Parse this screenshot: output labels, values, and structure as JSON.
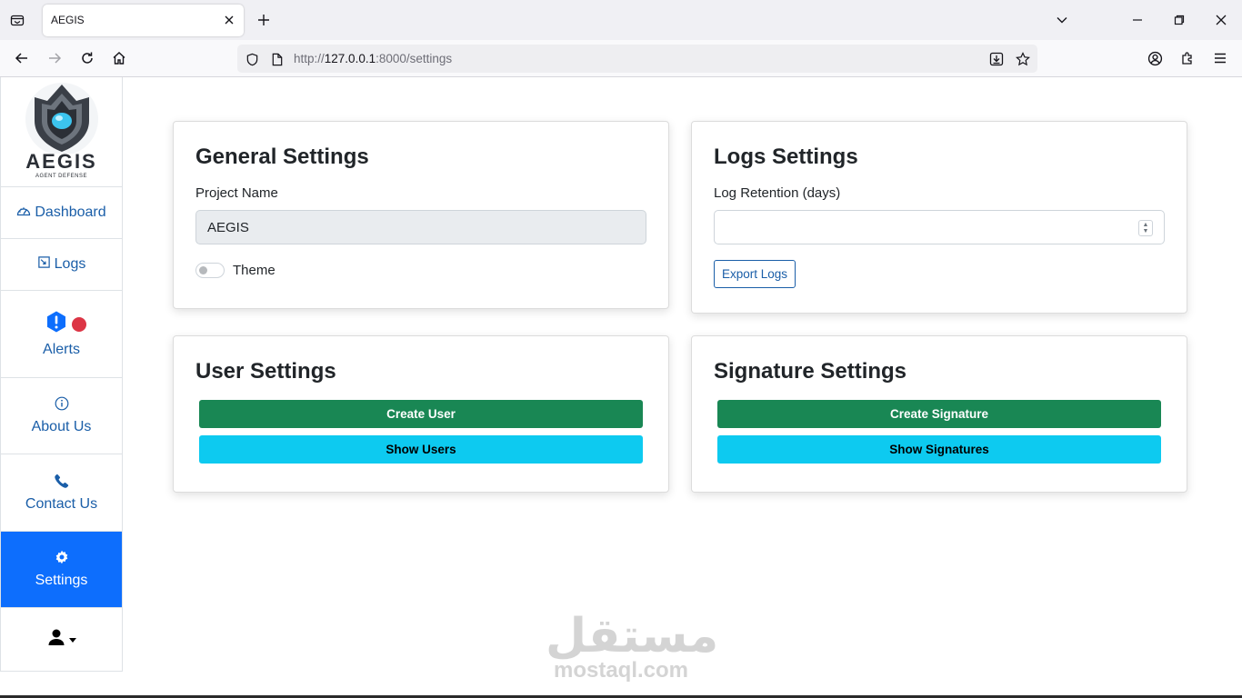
{
  "browser": {
    "tab_title": "AEGIS",
    "url_prefix": "http://",
    "url_host": "127.0.0.1",
    "url_path": ":8000/settings"
  },
  "sidebar": {
    "logo_word": "AEGIS",
    "logo_tag": "AGENT DEFENSE",
    "items": [
      {
        "label": "Dashboard",
        "icon": "speedometer-icon"
      },
      {
        "label": "Logs",
        "icon": "logs-icon"
      },
      {
        "label": "Alerts",
        "icon": "alert-icon"
      },
      {
        "label": "About Us",
        "icon": "info-icon"
      },
      {
        "label": "Contact Us",
        "icon": "phone-icon"
      },
      {
        "label": "Settings",
        "icon": "gear-icon"
      }
    ],
    "accent": "#0d6efd"
  },
  "general": {
    "title": "General Settings",
    "project_label": "Project Name",
    "project_value": "AEGIS",
    "theme_label": "Theme"
  },
  "logs": {
    "title": "Logs Settings",
    "retention_label": "Log Retention (days)",
    "retention_value": "",
    "export_label": "Export Logs"
  },
  "users": {
    "title": "User Settings",
    "create_label": "Create User",
    "show_label": "Show Users"
  },
  "signatures": {
    "title": "Signature Settings",
    "create_label": "Create Signature",
    "show_label": "Show Signatures"
  },
  "watermark": {
    "arabic": "مستقل",
    "latin": "mostaql.com"
  },
  "colors": {
    "green": "#198754",
    "cyan": "#0dcaf0",
    "danger": "#dc3545"
  }
}
